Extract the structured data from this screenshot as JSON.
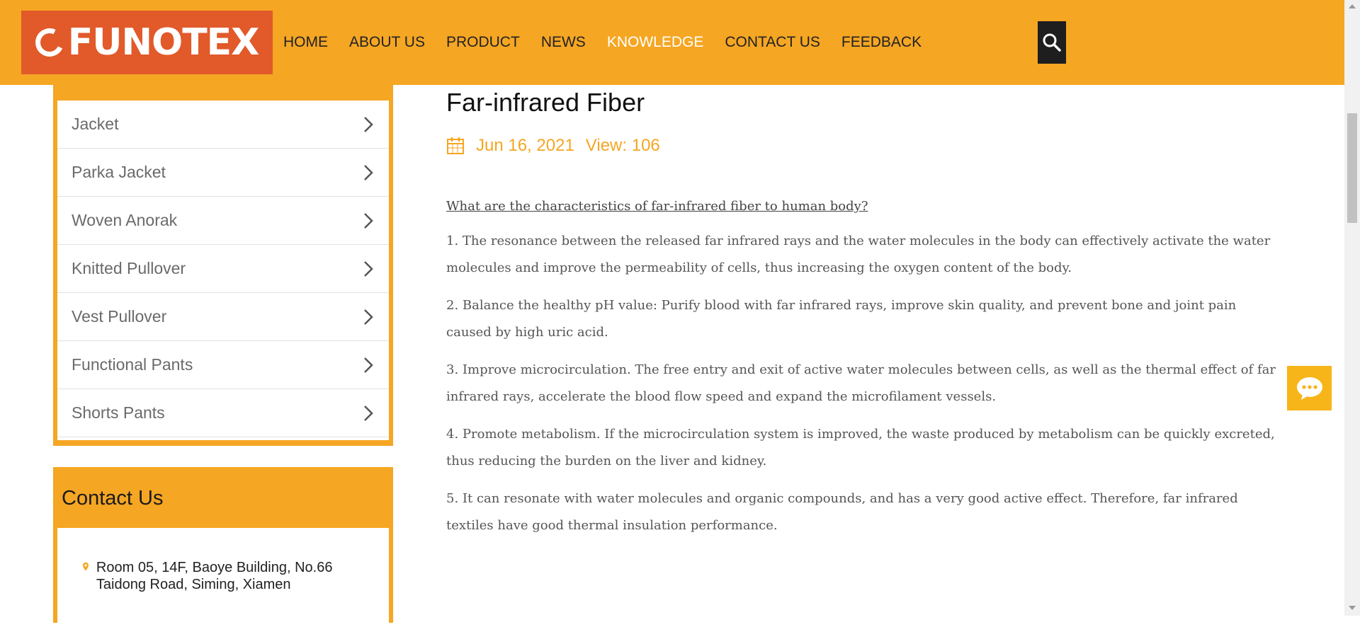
{
  "header": {
    "logo_text": "FUNOTEX",
    "brand_colors": {
      "header_bg": "#f5a623",
      "logo_bg": "#e2592a",
      "active_nav": "#ffffff"
    },
    "nav": [
      {
        "label": "HOME"
      },
      {
        "label": "ABOUT US"
      },
      {
        "label": "PRODUCT"
      },
      {
        "label": "NEWS"
      },
      {
        "label": "KNOWLEDGE",
        "active": true
      },
      {
        "label": "CONTACT US"
      },
      {
        "label": "FEEDBACK"
      }
    ],
    "search_icon": "search-icon"
  },
  "sidebar": {
    "categories": [
      {
        "label": "Jacket"
      },
      {
        "label": "Parka Jacket"
      },
      {
        "label": "Woven Anorak"
      },
      {
        "label": "Knitted Pullover"
      },
      {
        "label": "Vest Pullover"
      },
      {
        "label": "Functional Pants"
      },
      {
        "label": "Shorts Pants"
      }
    ],
    "contact": {
      "title": "Contact Us",
      "address": "Room 05, 14F, Baoye Building, No.66 Taidong Road, Siming, Xiamen",
      "address_icon": "location-pin-icon"
    }
  },
  "article": {
    "title": "Far-infrared Fiber",
    "date": "Jun 16, 2021",
    "views": "View: 106",
    "calendar_icon": "calendar-icon",
    "question": "What are the characteristics of far-infrared fiber to human body?",
    "paragraphs": [
      "1. The resonance between the released far infrared rays and the water molecules in the body can effectively activate the water molecules and improve the permeability of cells, thus increasing the oxygen content of the body.",
      "2. Balance the healthy pH value: Purify blood with far infrared rays, improve skin quality, and prevent bone and joint pain caused by high uric acid.",
      "3. Improve microcirculation. The free entry and exit of active water molecules between cells, as well as the thermal effect of far infrared rays, accelerate the blood flow speed and expand the microfilament vessels.",
      "4. Promote metabolism. If the microcirculation system is improved, the waste produced by metabolism can be quickly excreted, thus reducing the burden on the liver and kidney.",
      "5. It can resonate with water molecules and organic compounds, and has a very good active effect. Therefore, far infrared textiles have good thermal insulation performance."
    ]
  },
  "widgets": {
    "chat_icon": "chat-bubble-icon",
    "chat_color": "#f7b519"
  }
}
